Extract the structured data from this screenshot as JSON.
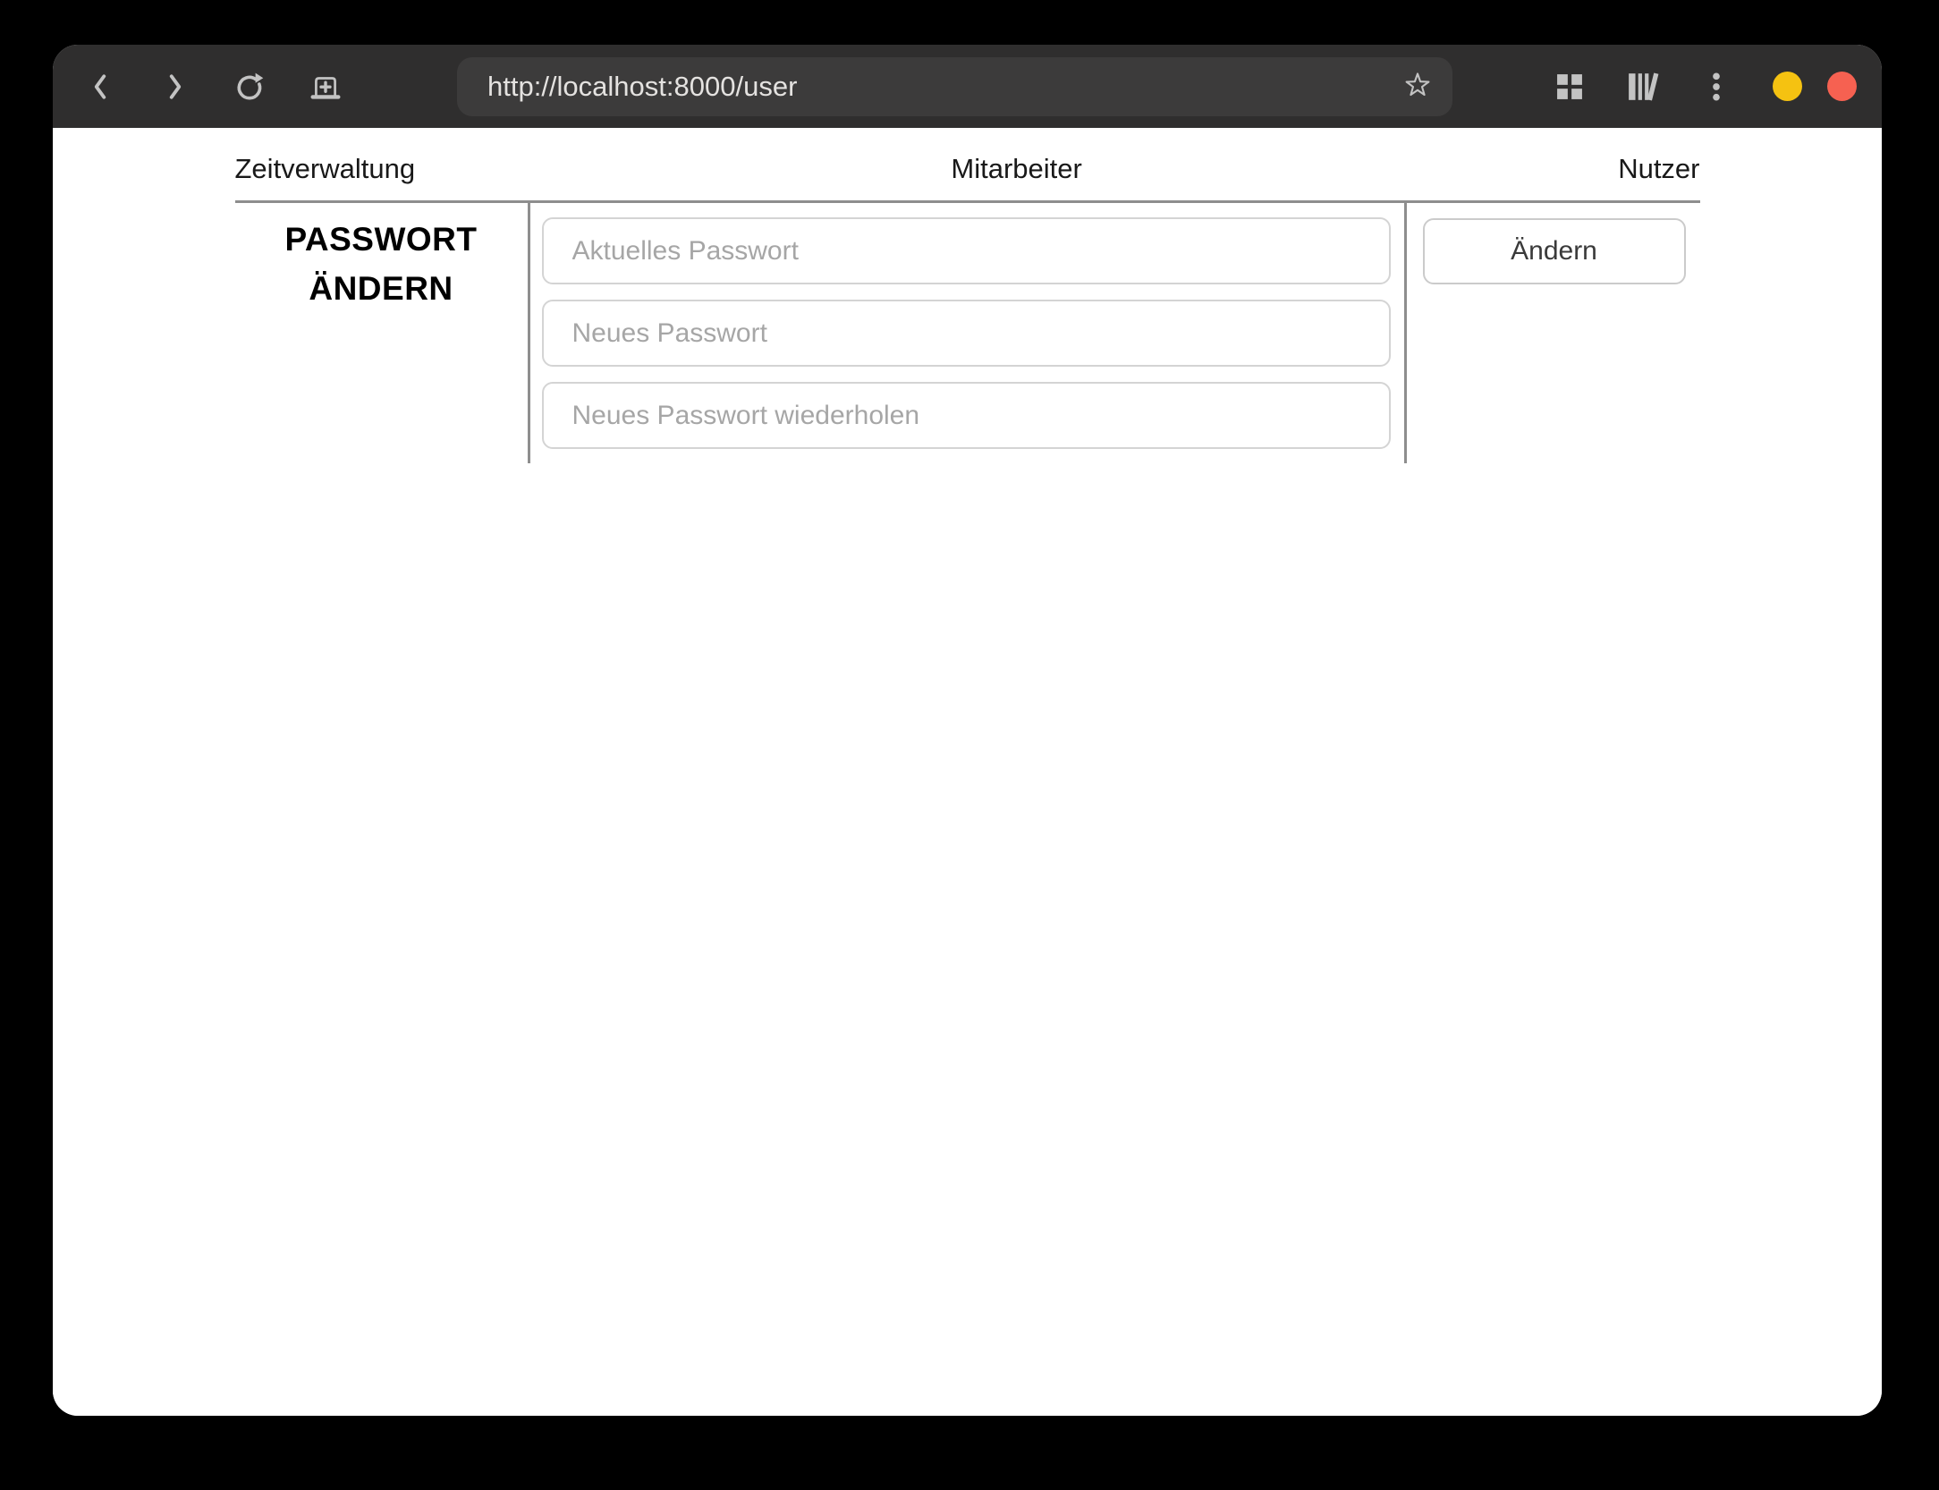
{
  "browser": {
    "toolbar": {
      "url": "http://localhost:8000/user",
      "icons": [
        "back-icon",
        "forward-icon",
        "reload-icon",
        "new-tab-icon",
        "bookmark-star-icon",
        "tab-overview-icon",
        "library-icon",
        "menu-kebab-icon",
        "minimize-button",
        "close-button"
      ]
    }
  },
  "page": {
    "nav": {
      "items": [
        {
          "label": "Zeitverwaltung"
        },
        {
          "label": "Mitarbeiter"
        },
        {
          "label": "Nutzer"
        }
      ]
    },
    "password_section": {
      "heading": "PASSWORT ÄNDERN",
      "fields": [
        {
          "placeholder": "Aktuelles Passwort"
        },
        {
          "placeholder": "Neues Passwort"
        },
        {
          "placeholder": "Neues Passwort wiederholen"
        }
      ],
      "submit_label": "Ändern"
    }
  },
  "colors": {
    "toolbar_bg": "#2f2e2e",
    "urlbar_bg": "#3c3b3b",
    "page_bg": "#ffffff",
    "table_divider": "#8e8e8e",
    "input_border": "#d4d4d4",
    "placeholder_text": "#a6a6a6",
    "minimize_yellow": "#f5c211",
    "close_red": "#f66151"
  }
}
